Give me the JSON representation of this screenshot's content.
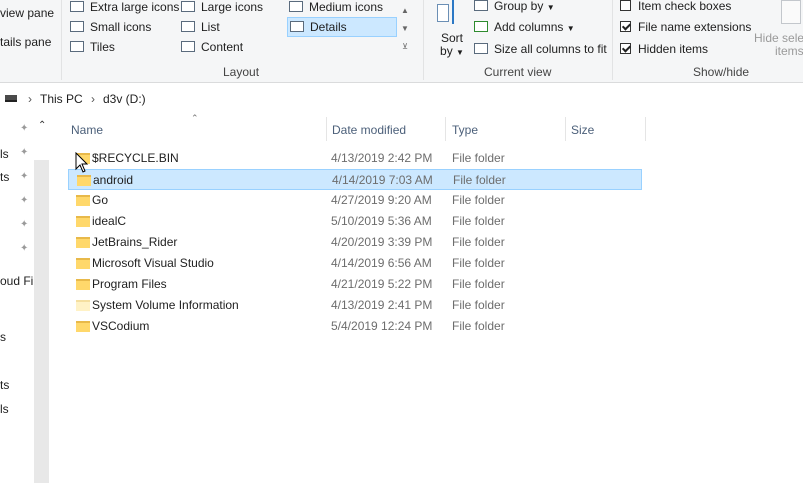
{
  "ribbon": {
    "panes": {
      "preview": "view pane",
      "details": "tails pane"
    },
    "layout": {
      "label": "Layout",
      "items": [
        {
          "label": "Extra large icons",
          "icon": "extra-large-icons-icon"
        },
        {
          "label": "Large icons",
          "icon": "large-icons-icon"
        },
        {
          "label": "Medium icons",
          "icon": "medium-icons-icon"
        },
        {
          "label": "Small icons",
          "icon": "small-icons-icon"
        },
        {
          "label": "List",
          "icon": "list-icon"
        },
        {
          "label": "Details",
          "icon": "details-icon",
          "selected": true
        },
        {
          "label": "Tiles",
          "icon": "tiles-icon"
        },
        {
          "label": "Content",
          "icon": "content-icon"
        }
      ]
    },
    "current_view": {
      "label": "Current view",
      "sort_by": "Sort\nby",
      "sort_label_1": "Sort",
      "sort_label_2": "by",
      "group_by": "Group by",
      "add_columns": "Add columns",
      "size_all_columns": "Size all columns to fit"
    },
    "show_hide": {
      "label": "Show/hide",
      "item_check_boxes": {
        "label": "Item check boxes",
        "checked": false
      },
      "file_name_extensions": {
        "label": "File name extensions",
        "checked": true
      },
      "hidden_items": {
        "label": "Hidden items",
        "checked": true
      },
      "hide_selected_1": "Hide selec",
      "hide_selected_2": "items"
    }
  },
  "address": {
    "crumbs": [
      "This PC",
      "d3v (D:)"
    ]
  },
  "nav_fragments": [
    "ls",
    "ts",
    "oud Fil",
    "s",
    "ts",
    "ls"
  ],
  "columns": [
    "Name",
    "Date modified",
    "Type",
    "Size"
  ],
  "files": [
    {
      "name": "$RECYCLE.BIN",
      "date": "4/13/2019 2:42 PM",
      "type": "File folder"
    },
    {
      "name": "android",
      "date": "4/14/2019 7:03 AM",
      "type": "File folder",
      "selected": true
    },
    {
      "name": "Go",
      "date": "4/27/2019 9:20 AM",
      "type": "File folder"
    },
    {
      "name": "idealC",
      "date": "5/10/2019 5:36 AM",
      "type": "File folder"
    },
    {
      "name": "JetBrains_Rider",
      "date": "4/20/2019 3:39 PM",
      "type": "File folder"
    },
    {
      "name": "Microsoft Visual Studio",
      "date": "4/14/2019 6:56 AM",
      "type": "File folder"
    },
    {
      "name": "Program Files",
      "date": "4/21/2019 5:22 PM",
      "type": "File folder"
    },
    {
      "name": "System Volume Information",
      "date": "4/13/2019 2:41 PM",
      "type": "File folder",
      "faint": true
    },
    {
      "name": "VSCodium",
      "date": "5/4/2019 12:24 PM",
      "type": "File folder"
    }
  ],
  "colors": {
    "selection": "#cce8ff",
    "selection_border": "#99d1ff",
    "folder": "#ffd86b",
    "header_text": "#4c607a"
  }
}
